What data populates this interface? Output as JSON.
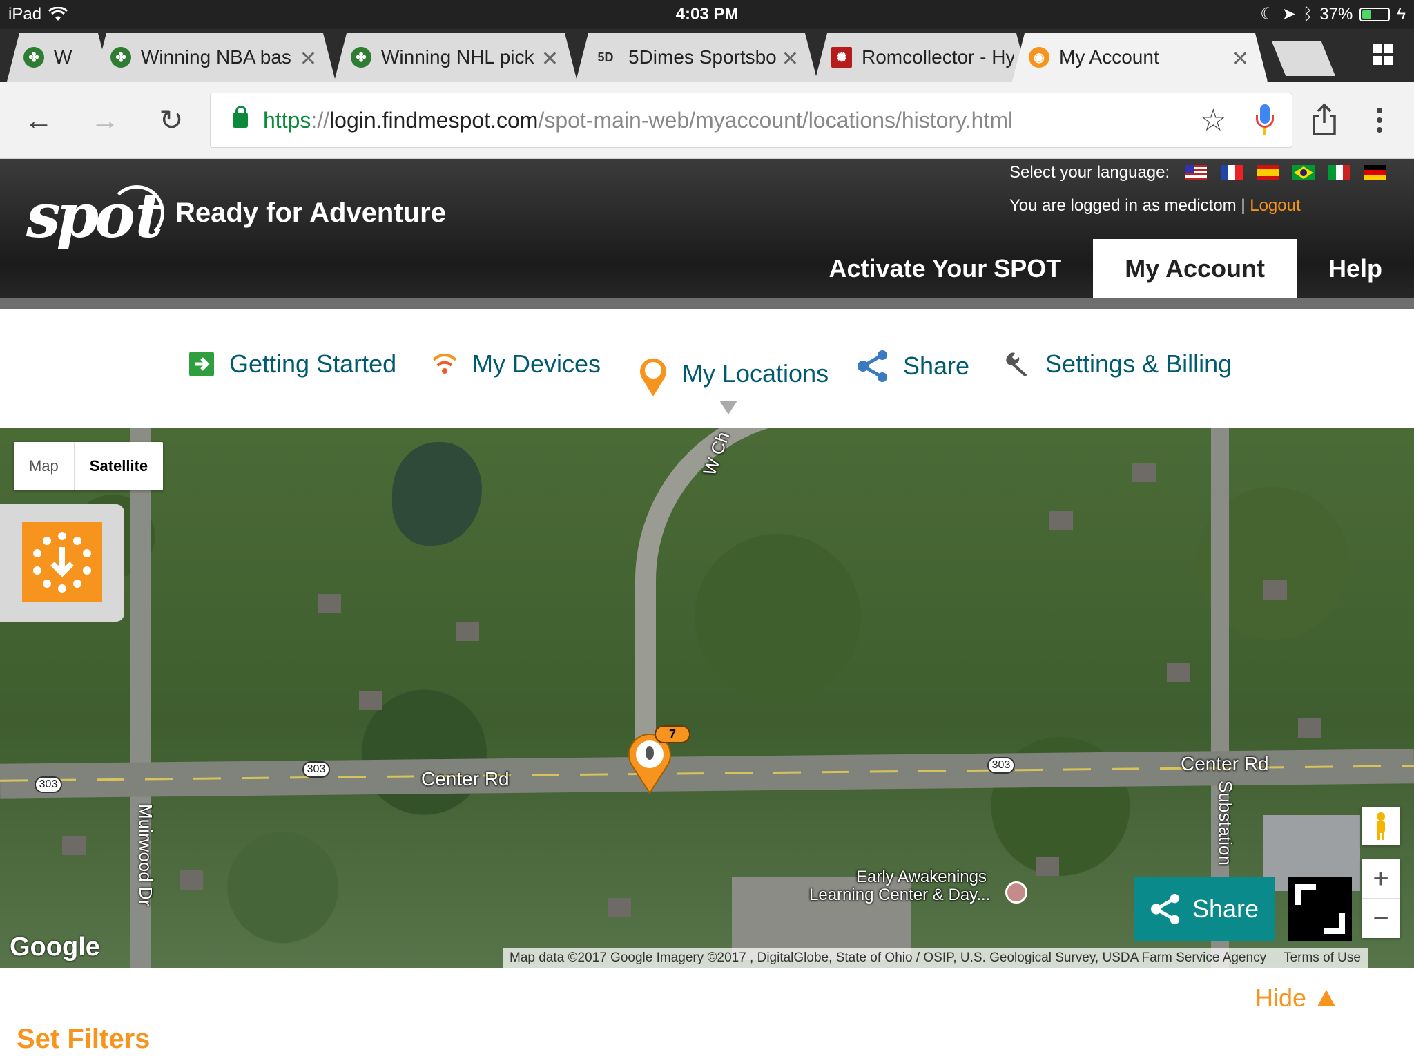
{
  "status_bar": {
    "device": "iPad",
    "time": "4:03 PM",
    "battery_percent": "37%",
    "battery_level": 0.37
  },
  "tabs": [
    {
      "title": "W",
      "favicon": "clover-favicon"
    },
    {
      "title": "Winning NBA bas",
      "favicon": "clover-favicon"
    },
    {
      "title": "Winning NHL pick",
      "favicon": "clover-favicon"
    },
    {
      "title": "5Dimes Sportsbo",
      "favicon_text": "5D"
    },
    {
      "title": "Romcollector - Hy",
      "favicon": "romcollector-favicon"
    },
    {
      "title": "My Account",
      "favicon": "spot-favicon",
      "active": true
    }
  ],
  "address_bar": {
    "scheme": "https",
    "separator": "://",
    "host": "login.findmespot.com",
    "path": "/spot-main-web/myaccount/locations/history.html"
  },
  "spot": {
    "tagline": "Ready for Adventure",
    "language_label": "Select your language:",
    "languages": [
      "us-flag",
      "france-flag",
      "spain-flag",
      "brazil-flag",
      "italy-flag",
      "germany-flag"
    ],
    "logged_in_text": "You are logged in as medictom |",
    "logout_label": "Logout",
    "main_nav": [
      "Activate Your SPOT",
      "My Account",
      "Help"
    ],
    "sub_nav": [
      "Getting Started",
      "My Devices",
      "My Locations",
      "Share",
      "Settings & Billing"
    ]
  },
  "map": {
    "map_type": {
      "map": "Map",
      "satellite": "Satellite"
    },
    "labels": {
      "center_rd_1": "Center Rd",
      "center_rd_2": "Center Rd",
      "route": "303",
      "muirwood": "Muirwood Dr",
      "substation": "Substation",
      "wc": "W Ch",
      "poi_line1": "Early Awakenings",
      "poi_line2": "Learning Center & Day..."
    },
    "marker_count": "7",
    "share_label": "Share",
    "google_logo": "Google",
    "attribution": "Map data ©2017 Google Imagery ©2017 , DigitalGlobe, State of Ohio / OSIP, U.S. Geological Survey, USDA Farm Service Agency",
    "terms": "Terms of Use"
  },
  "filters": {
    "hide_label": "Hide",
    "title": "Set Filters"
  },
  "colors": {
    "accent_orange": "#f7941d",
    "share_teal": "#0a8a8a",
    "nav_teal": "#005a70"
  }
}
